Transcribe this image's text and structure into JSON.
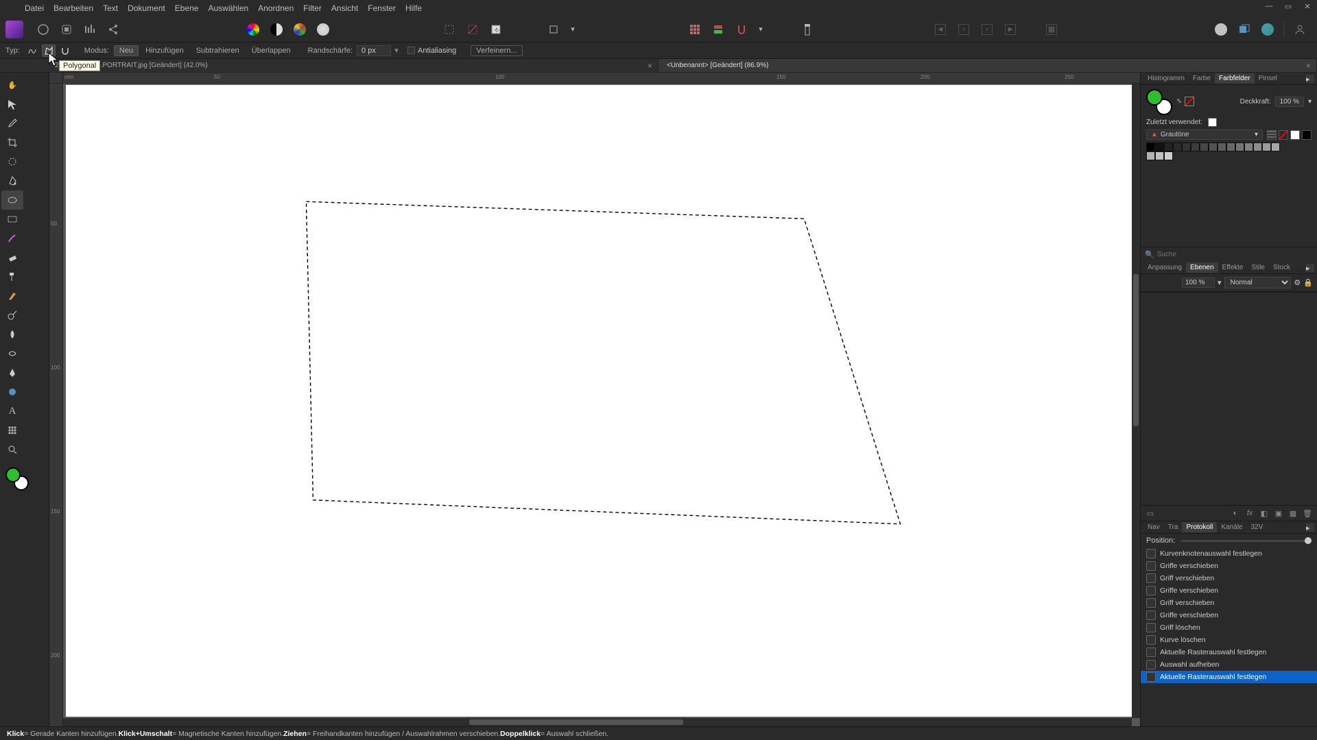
{
  "menu": {
    "datei": "Datei",
    "bearbeiten": "Bearbeiten",
    "text": "Text",
    "dokument": "Dokument",
    "ebene": "Ebene",
    "auswaehlen": "Auswählen",
    "anordnen": "Anordnen",
    "filter": "Filter",
    "ansicht": "Ansicht",
    "fenster": "Fenster",
    "hilfe": "Hilfe"
  },
  "tooltip": {
    "polygonal": "Polygonal"
  },
  "contextbar": {
    "typ_label": "Typ:",
    "modus_label": "Modus:",
    "neu": "Neu",
    "hinzufuegen": "Hinzufügen",
    "subtrahieren": "Subtrahieren",
    "ueberlappen": "Überlappen",
    "randschaerfe_label": "Randschärfe:",
    "randschaerfe_value": "0 px",
    "antialiasing": "Antialiasing",
    "verfeinern": "Verfeinern..."
  },
  "tabs": {
    "tab1": "25_140800269.PORTRAIT.jpg [Geändert] (42.0%)",
    "tab2": "<Unbenannt> [Geändert] (86.9%)"
  },
  "ruler_h": {
    "t0": "mm",
    "t1": "50",
    "t2": "100",
    "t3": "150",
    "t4": "200",
    "t5": "250"
  },
  "ruler_v": {
    "t1": "50",
    "t2": "100",
    "t3": "150",
    "t4": "200"
  },
  "right_tabs1": {
    "histogramm": "Histogramm",
    "farbe": "Farbe",
    "farbfelder": "Farbfelder",
    "pinsel": "Pinsel"
  },
  "swatches": {
    "deckkraft_label": "Deckkraft:",
    "deckkraft_value": "100 %",
    "zuletzt_label": "Zuletzt verwendet:",
    "grautoene": "Grautöne",
    "suche_placeholder": "Suche",
    "grays_row1": [
      "#000000",
      "#111111",
      "#222222",
      "#2a2a2a",
      "#333333",
      "#3c3c3c",
      "#474747",
      "#525252",
      "#5d5d5d",
      "#686868",
      "#747474",
      "#808080",
      "#8c8c8c",
      "#999999"
    ],
    "grays_row2": [
      "#a6a6a6",
      "#b3b3b3",
      "#c0c0c0",
      "#cdcdcd"
    ]
  },
  "right_tabs2": {
    "anpassung": "Anpassung",
    "ebenen": "Ebenen",
    "effekte": "Effekte",
    "stile": "Stile",
    "stock": "Stock"
  },
  "layers_ctrl": {
    "opacity": "100 %",
    "blend": "Normal"
  },
  "right_tabs3": {
    "nav": "Nav",
    "tra": "Tra",
    "protokoll": "Protokoll",
    "kanaele": "Kanäle",
    "v32": "32V"
  },
  "history": {
    "position_label": "Position:",
    "items": [
      "Kurvenknotenauswahl festlegen",
      "Griffe verschieben",
      "Griff verschieben",
      "Griffe verschieben",
      "Griff verschieben",
      "Griffe verschieben",
      "Griff löschen",
      "Kurve löschen",
      "Aktuelle Rasterauswahl festlegen",
      "Auswahl aufheben",
      "Aktuelle Rasterauswahl festlegen"
    ]
  },
  "status": {
    "klick": "Klick",
    "klick_desc": " = Gerade Kanten hinzufügen. ",
    "klick_umschalt": "Klick+Umschalt",
    "klick_umschalt_desc": " = Magnetische Kanten hinzufügen. ",
    "ziehen": "Ziehen",
    "ziehen_desc": " = Freihandkanten hinzufügen / Auswahlrahmen verschieben. ",
    "doppelklick": "Doppelklick",
    "doppelklick_desc": " = Auswahl schließen."
  }
}
